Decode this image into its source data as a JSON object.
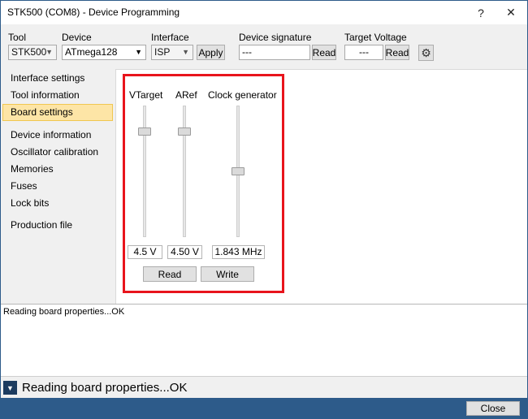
{
  "window": {
    "title": "STK500 (COM8) - Device Programming",
    "help_glyph": "?",
    "close_glyph": "✕"
  },
  "toolbar": {
    "tool_label": "Tool",
    "tool_value": "STK500",
    "device_label": "Device",
    "device_value": "ATmega128",
    "interface_label": "Interface",
    "interface_value": "ISP",
    "apply_label": "Apply",
    "signature_label": "Device signature",
    "signature_value": "---",
    "signature_read_label": "Read",
    "voltage_label": "Target Voltage",
    "voltage_value": "---",
    "voltage_read_label": "Read"
  },
  "sidebar": {
    "items": [
      {
        "label": "Interface settings"
      },
      {
        "label": "Tool information"
      },
      {
        "label": "Board settings",
        "selected": true
      },
      {
        "label": "Device information"
      },
      {
        "label": "Oscillator calibration"
      },
      {
        "label": "Memories"
      },
      {
        "label": "Fuses"
      },
      {
        "label": "Lock bits"
      },
      {
        "label": "Production file"
      }
    ]
  },
  "board": {
    "vtarget": {
      "label": "VTarget",
      "value": "4.5 V",
      "level": 0.82
    },
    "aref": {
      "label": "ARef",
      "value": "4.50 V",
      "level": 0.82
    },
    "clock": {
      "label": "Clock generator",
      "value": "1.843 MHz",
      "level": 0.5
    },
    "read_label": "Read",
    "write_label": "Write"
  },
  "log": {
    "line": "Reading board properties...OK"
  },
  "status": {
    "text": "Reading board properties...OK"
  },
  "footer": {
    "close_label": "Close"
  },
  "colors": {
    "accent": "#2d5b8a",
    "highlight_box": "#e8141c",
    "selected_nav": "#fde5a6"
  }
}
